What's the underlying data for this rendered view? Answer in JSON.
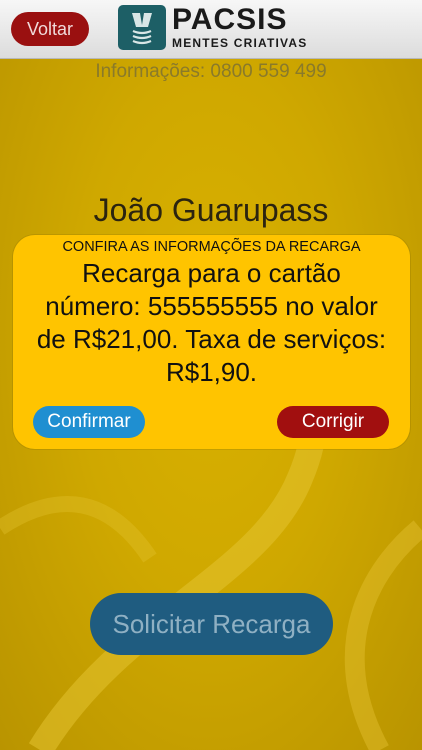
{
  "header": {
    "back_label": "Voltar",
    "logo_title": "PACSIS",
    "logo_subtitle": "MENTES CRIATIVAS"
  },
  "info_text": "Informações: 0800 559 499",
  "user_name": "João Guarupass",
  "request_button_label": "Solicitar Recarga",
  "dialog": {
    "title": "CONFIRA AS INFORMAÇÕES DA RECARGA",
    "message": "Recarga para o cartão número: 555555555 no valor de R$21,00. Taxa de serviços: R$1,90.",
    "confirm_label": "Confirmar",
    "fix_label": "Corrigir"
  },
  "colors": {
    "background": "#cfa800",
    "dialog": "#ffc400",
    "confirm": "#1f8fd1",
    "fix": "#a10f0f",
    "back": "#9a1010",
    "request": "#1f5c80"
  }
}
